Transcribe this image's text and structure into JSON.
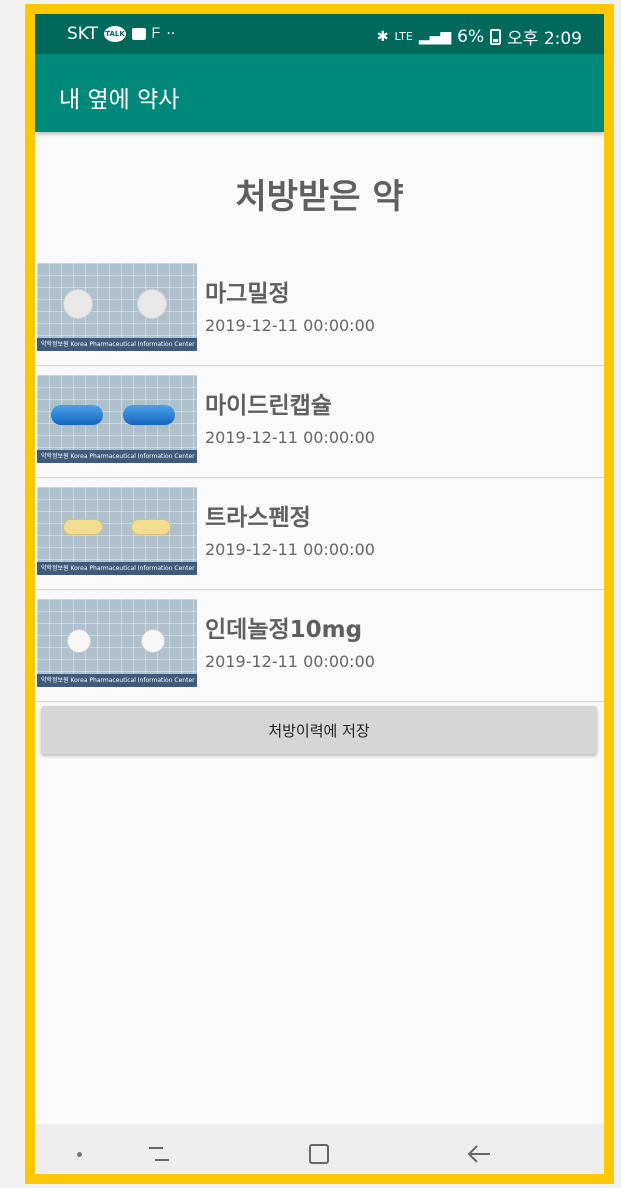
{
  "status_bar": {
    "carrier": "SKT",
    "talk_label": "TALK",
    "network": "LTE",
    "battery": "6%",
    "time": "오후 2:09"
  },
  "app_bar": {
    "title": "내 옆에 약사"
  },
  "page": {
    "title": "처방받은 약"
  },
  "medicines": [
    {
      "name": "마그밀정",
      "date": "2019-12-11 00:00:00",
      "pill": "round-white"
    },
    {
      "name": "마이드린캡슐",
      "date": "2019-12-11 00:00:00",
      "pill": "capsule-blue"
    },
    {
      "name": "트라스펜정",
      "date": "2019-12-11 00:00:00",
      "pill": "oblong-yellow"
    },
    {
      "name": "인데놀정10mg",
      "date": "2019-12-11 00:00:00",
      "pill": "small-white"
    }
  ],
  "thumbnail_caption": "약학정보원  Korea Pharmaceutical Information Center",
  "save_button": {
    "label": "처방이력에 저장"
  },
  "colors": {
    "status_bar": "#00695c",
    "app_bar": "#00897b",
    "frame_border": "#fdc800"
  },
  "nav_bar": {
    "icons": [
      "dot-icon",
      "recent-apps-icon",
      "home-icon",
      "back-icon"
    ]
  }
}
